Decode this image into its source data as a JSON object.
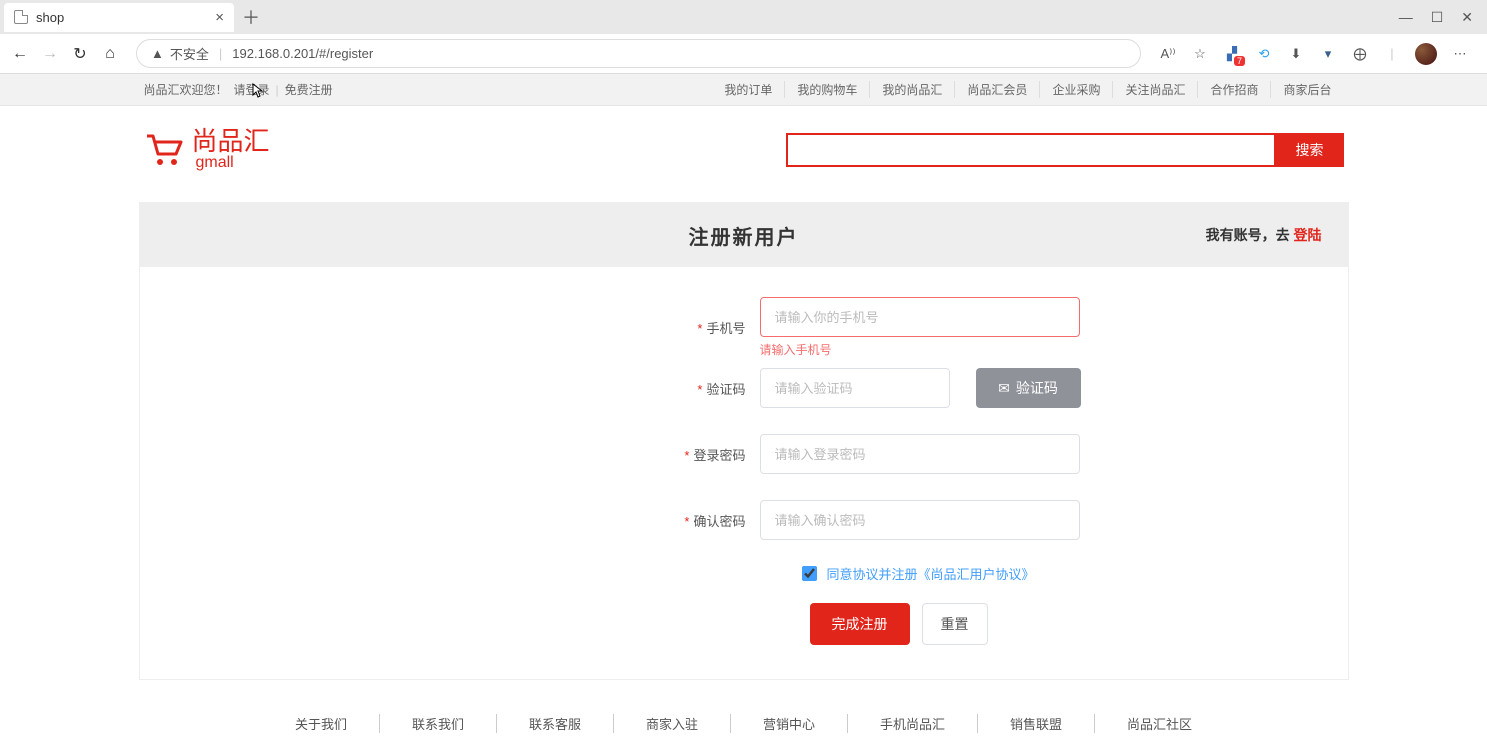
{
  "browser": {
    "tab_title": "shop",
    "url_warning": "不安全",
    "url": "192.168.0.201/#/register",
    "read_aloud": "A⁾⁾",
    "ext_badge": "7"
  },
  "topbar": {
    "welcome": "尚品汇欢迎您！",
    "login": "请登录",
    "register": "免费注册",
    "links": [
      "我的订单",
      "我的购物车",
      "我的尚品汇",
      "尚品汇会员",
      "企业采购",
      "关注尚品汇",
      "合作招商",
      "商家后台"
    ]
  },
  "header": {
    "brand_cn": "尚品汇",
    "brand_en": "gmall",
    "search_btn": "搜索"
  },
  "register": {
    "title": "注册新用户",
    "have_account": "我有账号，去 ",
    "login_link": "登陆",
    "phone_label": "手机号",
    "phone_placeholder": "请输入你的手机号",
    "phone_error": "请输入手机号",
    "code_label": "验证码",
    "code_placeholder": "请输入验证码",
    "code_btn": "验证码",
    "pwd_label": "登录密码",
    "pwd_placeholder": "请输入登录密码",
    "pwd2_label": "确认密码",
    "pwd2_placeholder": "请输入确认密码",
    "agree_text": "同意协议并注册《尚品汇用户协议》",
    "submit": "完成注册",
    "reset": "重置"
  },
  "footer": [
    "关于我们",
    "联系我们",
    "联系客服",
    "商家入驻",
    "营销中心",
    "手机尚品汇",
    "销售联盟",
    "尚品汇社区"
  ]
}
